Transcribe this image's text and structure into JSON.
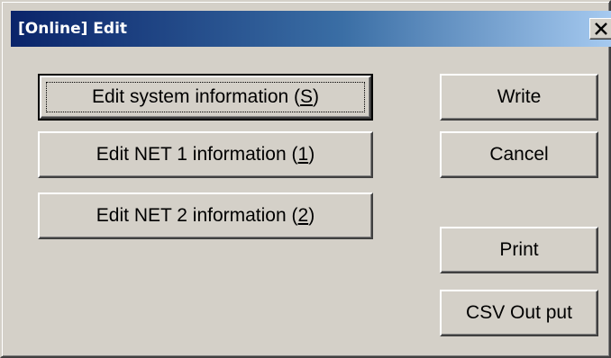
{
  "window": {
    "title": "[Online] Edit",
    "close_label": "✕"
  },
  "buttons": {
    "edit_system": {
      "label": "Edit system information (",
      "mnemonic": "S",
      "suffix": ")"
    },
    "edit_net1": {
      "label": "Edit NET 1 information (",
      "mnemonic": "1",
      "suffix": ")"
    },
    "edit_net2": {
      "label": "Edit NET 2 information (",
      "mnemonic": "2",
      "suffix": ")"
    },
    "write": "Write",
    "cancel": "Cancel",
    "print": "Print",
    "csv_output": "CSV Out put"
  },
  "colors": {
    "face": "#d4d0c8",
    "title_gradient_start": "#0a246a",
    "title_gradient_end": "#a6caf0"
  },
  "icons": {
    "close": "close-icon"
  }
}
